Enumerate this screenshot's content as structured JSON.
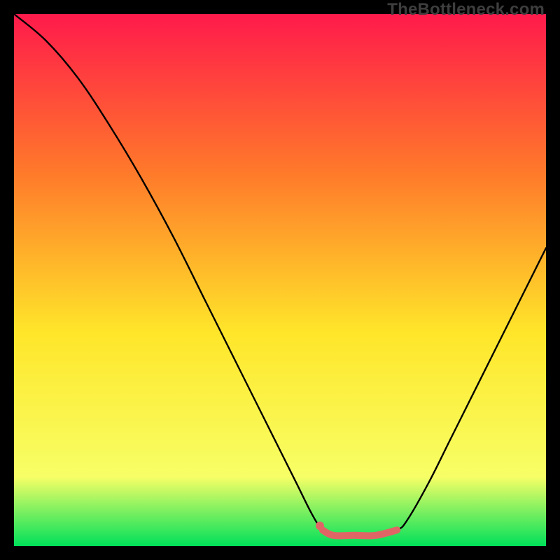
{
  "watermark": "TheBottleneck.com",
  "chart_data": {
    "type": "line",
    "title": "",
    "xlabel": "",
    "ylabel": "",
    "xlim": [
      0,
      100
    ],
    "ylim": [
      0,
      100
    ],
    "background_gradient": {
      "top": "#ff1a4b",
      "midtop": "#ff7a2a",
      "mid": "#ffe62a",
      "midbot": "#f7ff66",
      "bot": "#00e05a"
    },
    "series": [
      {
        "name": "curve",
        "stroke": "#000000",
        "points": [
          {
            "x": 0,
            "y": 100
          },
          {
            "x": 6,
            "y": 95
          },
          {
            "x": 12,
            "y": 88
          },
          {
            "x": 18,
            "y": 79
          },
          {
            "x": 24,
            "y": 69
          },
          {
            "x": 30,
            "y": 58
          },
          {
            "x": 36,
            "y": 46
          },
          {
            "x": 42,
            "y": 34
          },
          {
            "x": 48,
            "y": 22
          },
          {
            "x": 53,
            "y": 12
          },
          {
            "x": 56,
            "y": 6
          },
          {
            "x": 58,
            "y": 3
          },
          {
            "x": 60,
            "y": 2
          },
          {
            "x": 64,
            "y": 2
          },
          {
            "x": 68,
            "y": 2
          },
          {
            "x": 72,
            "y": 3
          },
          {
            "x": 74,
            "y": 5
          },
          {
            "x": 78,
            "y": 12
          },
          {
            "x": 82,
            "y": 20
          },
          {
            "x": 86,
            "y": 28
          },
          {
            "x": 90,
            "y": 36
          },
          {
            "x": 94,
            "y": 44
          },
          {
            "x": 98,
            "y": 52
          },
          {
            "x": 100,
            "y": 56
          }
        ]
      },
      {
        "name": "marker-band",
        "stroke": "#e06666",
        "points": [
          {
            "x": 58,
            "y": 3
          },
          {
            "x": 60,
            "y": 2
          },
          {
            "x": 64,
            "y": 2
          },
          {
            "x": 68,
            "y": 2
          },
          {
            "x": 72,
            "y": 3
          }
        ]
      },
      {
        "name": "marker-dot",
        "stroke": "#e06666",
        "points": [
          {
            "x": 57.5,
            "y": 3.8
          }
        ]
      }
    ]
  }
}
